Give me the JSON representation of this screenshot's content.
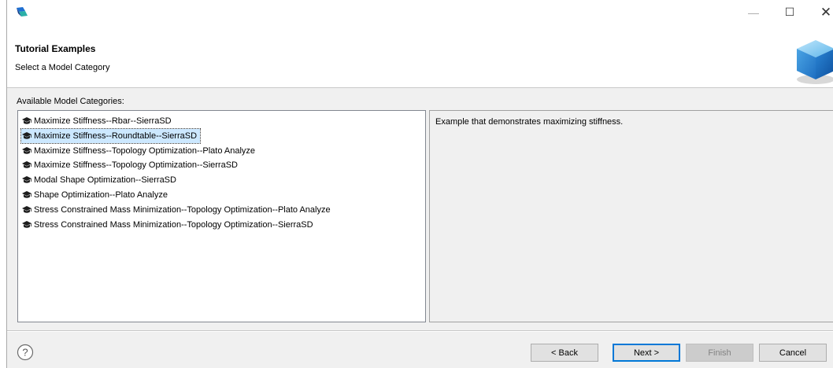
{
  "window": {
    "controls": {
      "minimize": "—",
      "maximize": "☐",
      "close": "✕"
    }
  },
  "banner": {
    "title": "Tutorial Examples",
    "subtitle": "Select a Model Category"
  },
  "categories": {
    "label": "Available Model Categories:",
    "items": [
      {
        "label": "Maximize Stiffness--Rbar--SierraSD",
        "selected": false
      },
      {
        "label": "Maximize Stiffness--Roundtable--SierraSD",
        "selected": true
      },
      {
        "label": "Maximize Stiffness--Topology Optimization--Plato Analyze",
        "selected": false
      },
      {
        "label": "Maximize Stiffness--Topology Optimization--SierraSD",
        "selected": false
      },
      {
        "label": "Modal Shape Optimization--SierraSD",
        "selected": false
      },
      {
        "label": "Shape Optimization--Plato Analyze",
        "selected": false
      },
      {
        "label": "Stress Constrained Mass Minimization--Topology Optimization--Plato Analyze",
        "selected": false
      },
      {
        "label": "Stress Constrained Mass Minimization--Topology Optimization--SierraSD",
        "selected": false
      }
    ],
    "item_icon": "graduation-cap-icon"
  },
  "description": {
    "text": "Example that demonstrates maximizing stiffness."
  },
  "footer": {
    "help_icon": "help-question-icon",
    "back_label": "< Back",
    "next_label": "Next >",
    "finish_label": "Finish",
    "cancel_label": "Cancel",
    "finish_enabled": false
  },
  "colors": {
    "selection": "#cce8ff",
    "default_button_border": "#0078d7",
    "dialog_background": "#f0f0f0"
  }
}
